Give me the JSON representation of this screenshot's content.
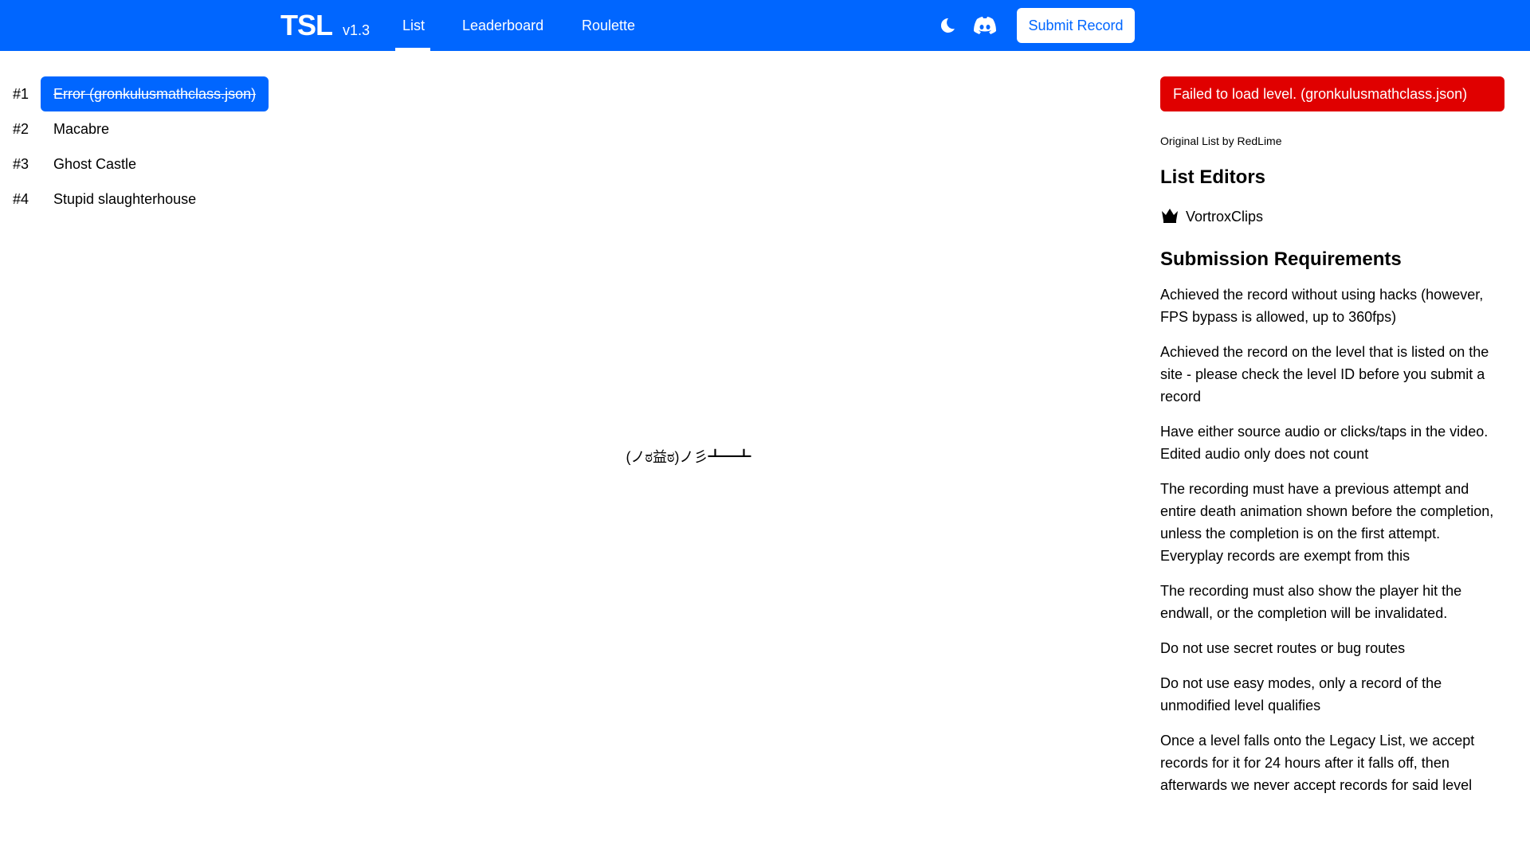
{
  "nav": {
    "logo": "TSL",
    "version": "v1.3",
    "links": [
      "List",
      "Leaderboard",
      "Roulette"
    ],
    "active": "List",
    "submit_label": "Submit Record",
    "icons": [
      "moon-icon",
      "discord-icon"
    ]
  },
  "colors": {
    "brand": "#0066ff",
    "error": "#e00000"
  },
  "list": [
    {
      "rank": "#1",
      "name": "Error (gronkulusmathclass.json)",
      "selected": true
    },
    {
      "rank": "#2",
      "name": "Macabre"
    },
    {
      "rank": "#3",
      "name": "Ghost Castle"
    },
    {
      "rank": "#4",
      "name": "Stupid slaughterhouse"
    }
  ],
  "main": {
    "error_face": "(ノಠ益ಠ)ノ彡┻━┻"
  },
  "sidebar": {
    "error": "Failed to load level. (gronkulusmathclass.json)",
    "original": "Original List by RedLime",
    "editors_title": "List Editors",
    "editors": [
      "VortroxClips"
    ],
    "requirements_title": "Submission Requirements",
    "requirements": [
      "Achieved the record without using hacks (however, FPS bypass is allowed, up to 360fps)",
      "Achieved the record on the level that is listed on the site - please check the level ID before you submit a record",
      "Have either source audio or clicks/taps in the video. Edited audio only does not count",
      "The recording must have a previous attempt and entire death animation shown before the completion, unless the completion is on the first attempt. Everyplay records are exempt from this",
      "The recording must also show the player hit the endwall, or the completion will be invalidated.",
      "Do not use secret routes or bug routes",
      "Do not use easy modes, only a record of the unmodified level qualifies",
      "Once a level falls onto the Legacy List, we accept records for it for 24 hours after it falls off, then afterwards we never accept records for said level"
    ]
  }
}
